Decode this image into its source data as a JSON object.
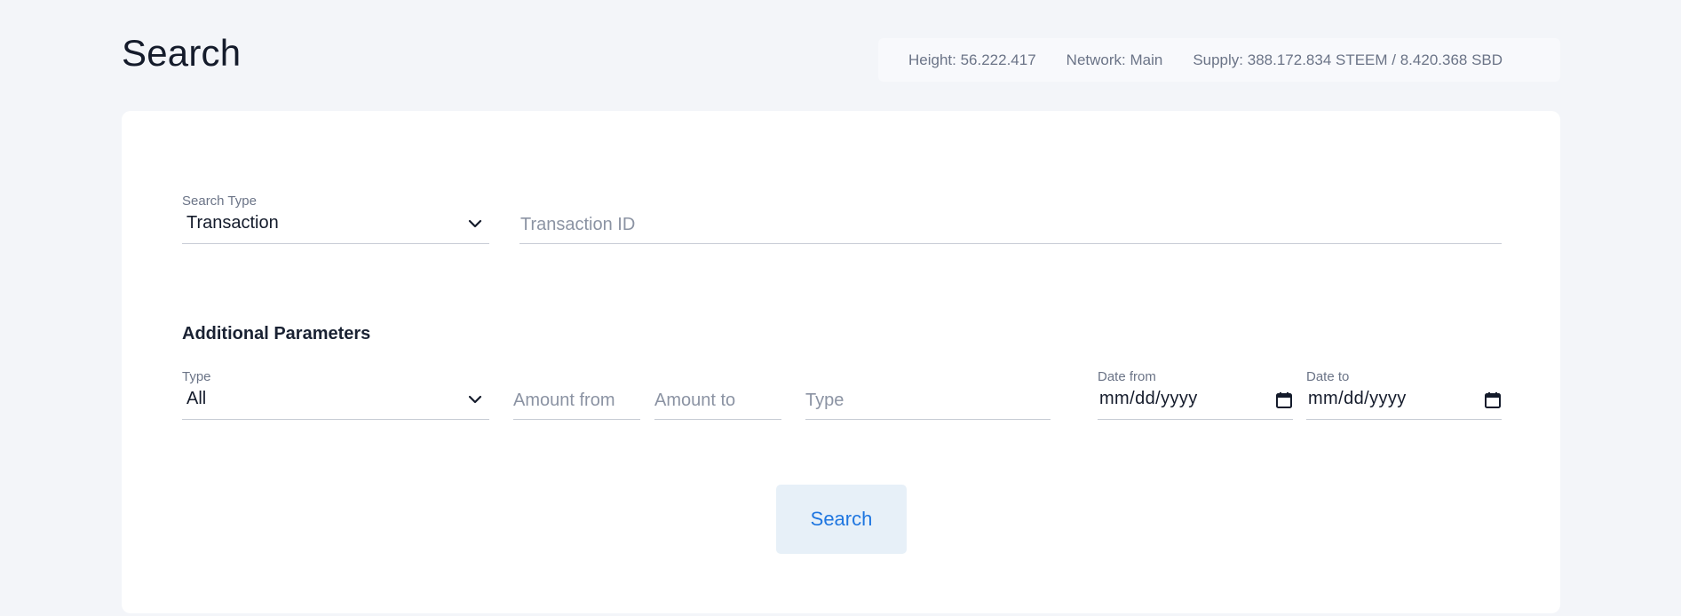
{
  "header": {
    "title": "Search"
  },
  "stats": {
    "height": "Height: 56.222.417",
    "network": "Network: Main",
    "supply": "Supply: 388.172.834 STEEM / 8.420.368 SBD"
  },
  "search": {
    "type_label": "Search Type",
    "type_value": "Transaction",
    "id_placeholder": "Transaction ID"
  },
  "additional": {
    "heading": "Additional Parameters",
    "type_label": "Type",
    "type_value": "All",
    "amount_from_placeholder": "Amount from",
    "amount_to_placeholder": "Amount to",
    "op_type_placeholder": "Type",
    "date_from_label": "Date from",
    "date_from_value": "mm/dd/yyyy",
    "date_to_label": "Date to",
    "date_to_value": "mm/dd/yyyy"
  },
  "actions": {
    "search_label": "Search"
  },
  "icons": {
    "select_chevron": "chevron-down-icon",
    "date_picker": "calendar-icon"
  },
  "colors": {
    "accent": "#1f76e0",
    "button_bg": "#e7f0f8",
    "page_bg": "#f3f5f9"
  }
}
